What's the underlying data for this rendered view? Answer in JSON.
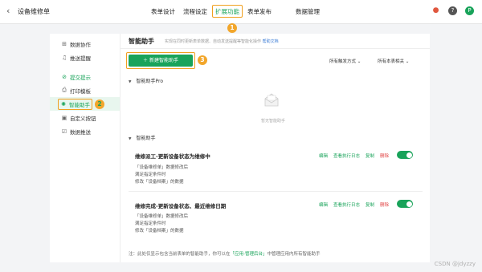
{
  "header": {
    "back_icon": "chevron-left-icon",
    "app_title": "设备维修单",
    "tabs": [
      "表单设计",
      "流程设定",
      "扩展功能",
      "表单发布",
      "数据管理"
    ],
    "active_tab": "扩展功能",
    "marker1": "1",
    "icons": [
      {
        "name": "notification-icon",
        "color": "#e0573e",
        "glyph": "🔔"
      },
      {
        "name": "help-icon",
        "color": "#555555",
        "glyph": "?"
      },
      {
        "name": "avatar",
        "color": "#19a35a",
        "glyph": "P"
      }
    ]
  },
  "sidebar": {
    "items": [
      {
        "label": "数据协作",
        "icon": "collab-icon",
        "glyph": "⊞"
      },
      {
        "label": "推送提醒",
        "icon": "bell-icon",
        "glyph": "♫"
      },
      {
        "label": "提交提示",
        "icon": "check-circle-icon",
        "glyph": "⊘"
      },
      {
        "label": "打印模板",
        "icon": "printer-icon",
        "glyph": "⎙"
      },
      {
        "label": "智能助手",
        "icon": "bulb-icon",
        "glyph": "✺"
      },
      {
        "label": "自定义按钮",
        "icon": "custom-button-icon",
        "glyph": "▣"
      },
      {
        "label": "数据推送",
        "icon": "push-icon",
        "glyph": "☑"
      }
    ],
    "active": "智能助手",
    "marker2": "2"
  },
  "main": {
    "title": "智能助手",
    "desc": "实现在同时更新表单数据、自动发送提醒等智能化操作",
    "desc_link": "帮助文档",
    "new_button": "＋ 新建智能助手",
    "marker3": "3",
    "filter1": "所有触发方式 ⌄",
    "filter2": "所有本表相关 ⌄",
    "section_pro": "智能助手Pro",
    "empty_text": "暂无智能助手",
    "section": "智能助手",
    "cards": [
      {
        "title": "维修派工-更新设备状态为维修中",
        "lines": [
          "「设备维修单」数据修改后",
          "满足指定条件时",
          "修改「设备档案」的数据"
        ],
        "actions": [
          "编辑",
          "查看执行日志",
          "复制",
          "删除"
        ],
        "enabled": true
      },
      {
        "title": "维修完成-更新设备状态、最近维修日期",
        "lines": [
          "「设备维修单」数据修改后",
          "满足指定条件时",
          "修改「设备档案」的数据"
        ],
        "actions": [
          "编辑",
          "查看执行日志",
          "复制",
          "删除"
        ],
        "enabled": true
      }
    ],
    "note_pre": "注：此处仅显示包含当前表单的智能助手，你可以在",
    "note_link": "「应用-管理后台」",
    "note_post": "中管理应用内所有智能助手"
  },
  "watermark": "CSDN @jdyzzy"
}
